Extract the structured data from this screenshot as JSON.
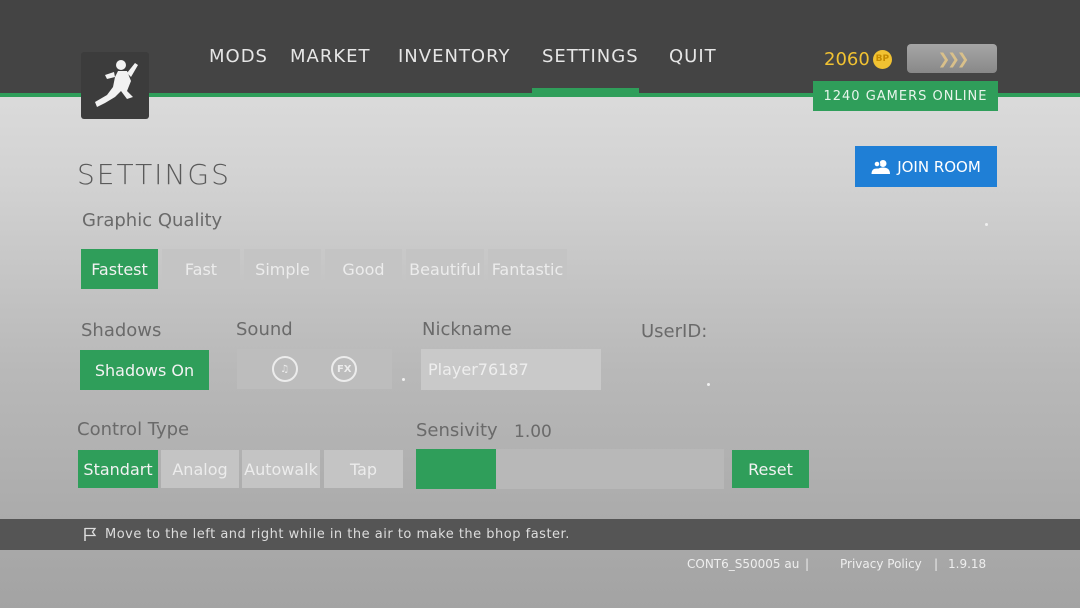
{
  "nav": {
    "items": [
      {
        "label": "MODS"
      },
      {
        "label": "MARKET"
      },
      {
        "label": "INVENTORY"
      },
      {
        "label": "SETTINGS"
      },
      {
        "label": "QUIT"
      }
    ],
    "active_index": 3
  },
  "header": {
    "coins": "2060",
    "coin_symbol": "BP",
    "rank_symbol": "❯❯❯",
    "online_text": "1240 GAMERS ONLINE"
  },
  "page": {
    "title": "SETTINGS",
    "join_room_label": "JOIN ROOM"
  },
  "graphic_quality": {
    "label": "Graphic Quality",
    "options": [
      "Fastest",
      "Fast",
      "Simple",
      "Good",
      "Beautiful",
      "Fantastic"
    ],
    "selected": "Fastest"
  },
  "shadows": {
    "label": "Shadows",
    "button_label": "Shadows On"
  },
  "sound": {
    "label": "Sound",
    "music_glyph": "♫",
    "fx_glyph": "FX"
  },
  "nickname": {
    "label": "Nickname",
    "value": "Player76187"
  },
  "user_id": {
    "label": "UserID:"
  },
  "control_type": {
    "label": "Control Type",
    "options": [
      "Standart",
      "Analog",
      "Autowalk",
      "Tap"
    ],
    "selected": "Standart"
  },
  "sensitivity": {
    "label": "Sensivity",
    "value_text": "1.00",
    "fill_fraction": 0.26,
    "reset_label": "Reset"
  },
  "tip": {
    "text": "Move to the left and right while in the air to make the bhop faster."
  },
  "footer": {
    "build_id": "CONT6_S50005 au",
    "separator": "|",
    "privacy_label": "Privacy Policy",
    "version": "1.9.18"
  },
  "colors": {
    "accent_green": "#2f9e5a",
    "join_blue": "#1f7fd6",
    "coin_gold": "#f1c232",
    "topbar": "#444444"
  }
}
